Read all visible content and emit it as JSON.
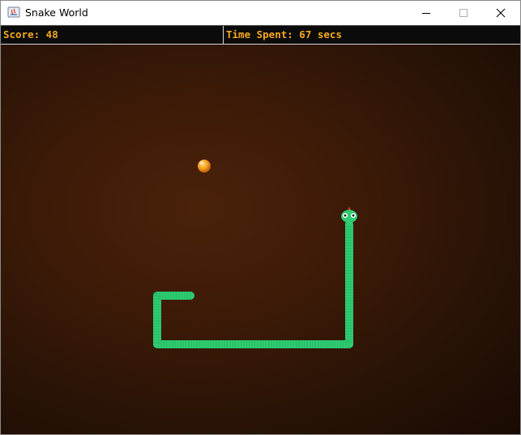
{
  "window": {
    "title": "Snake World"
  },
  "hud": {
    "score_text": "Score: 48",
    "time_text": "Time Spent: 67 secs"
  },
  "game": {
    "snake_color": "#2ecc71",
    "food_color": "#f5a623",
    "background_color": "#3c1a07"
  }
}
